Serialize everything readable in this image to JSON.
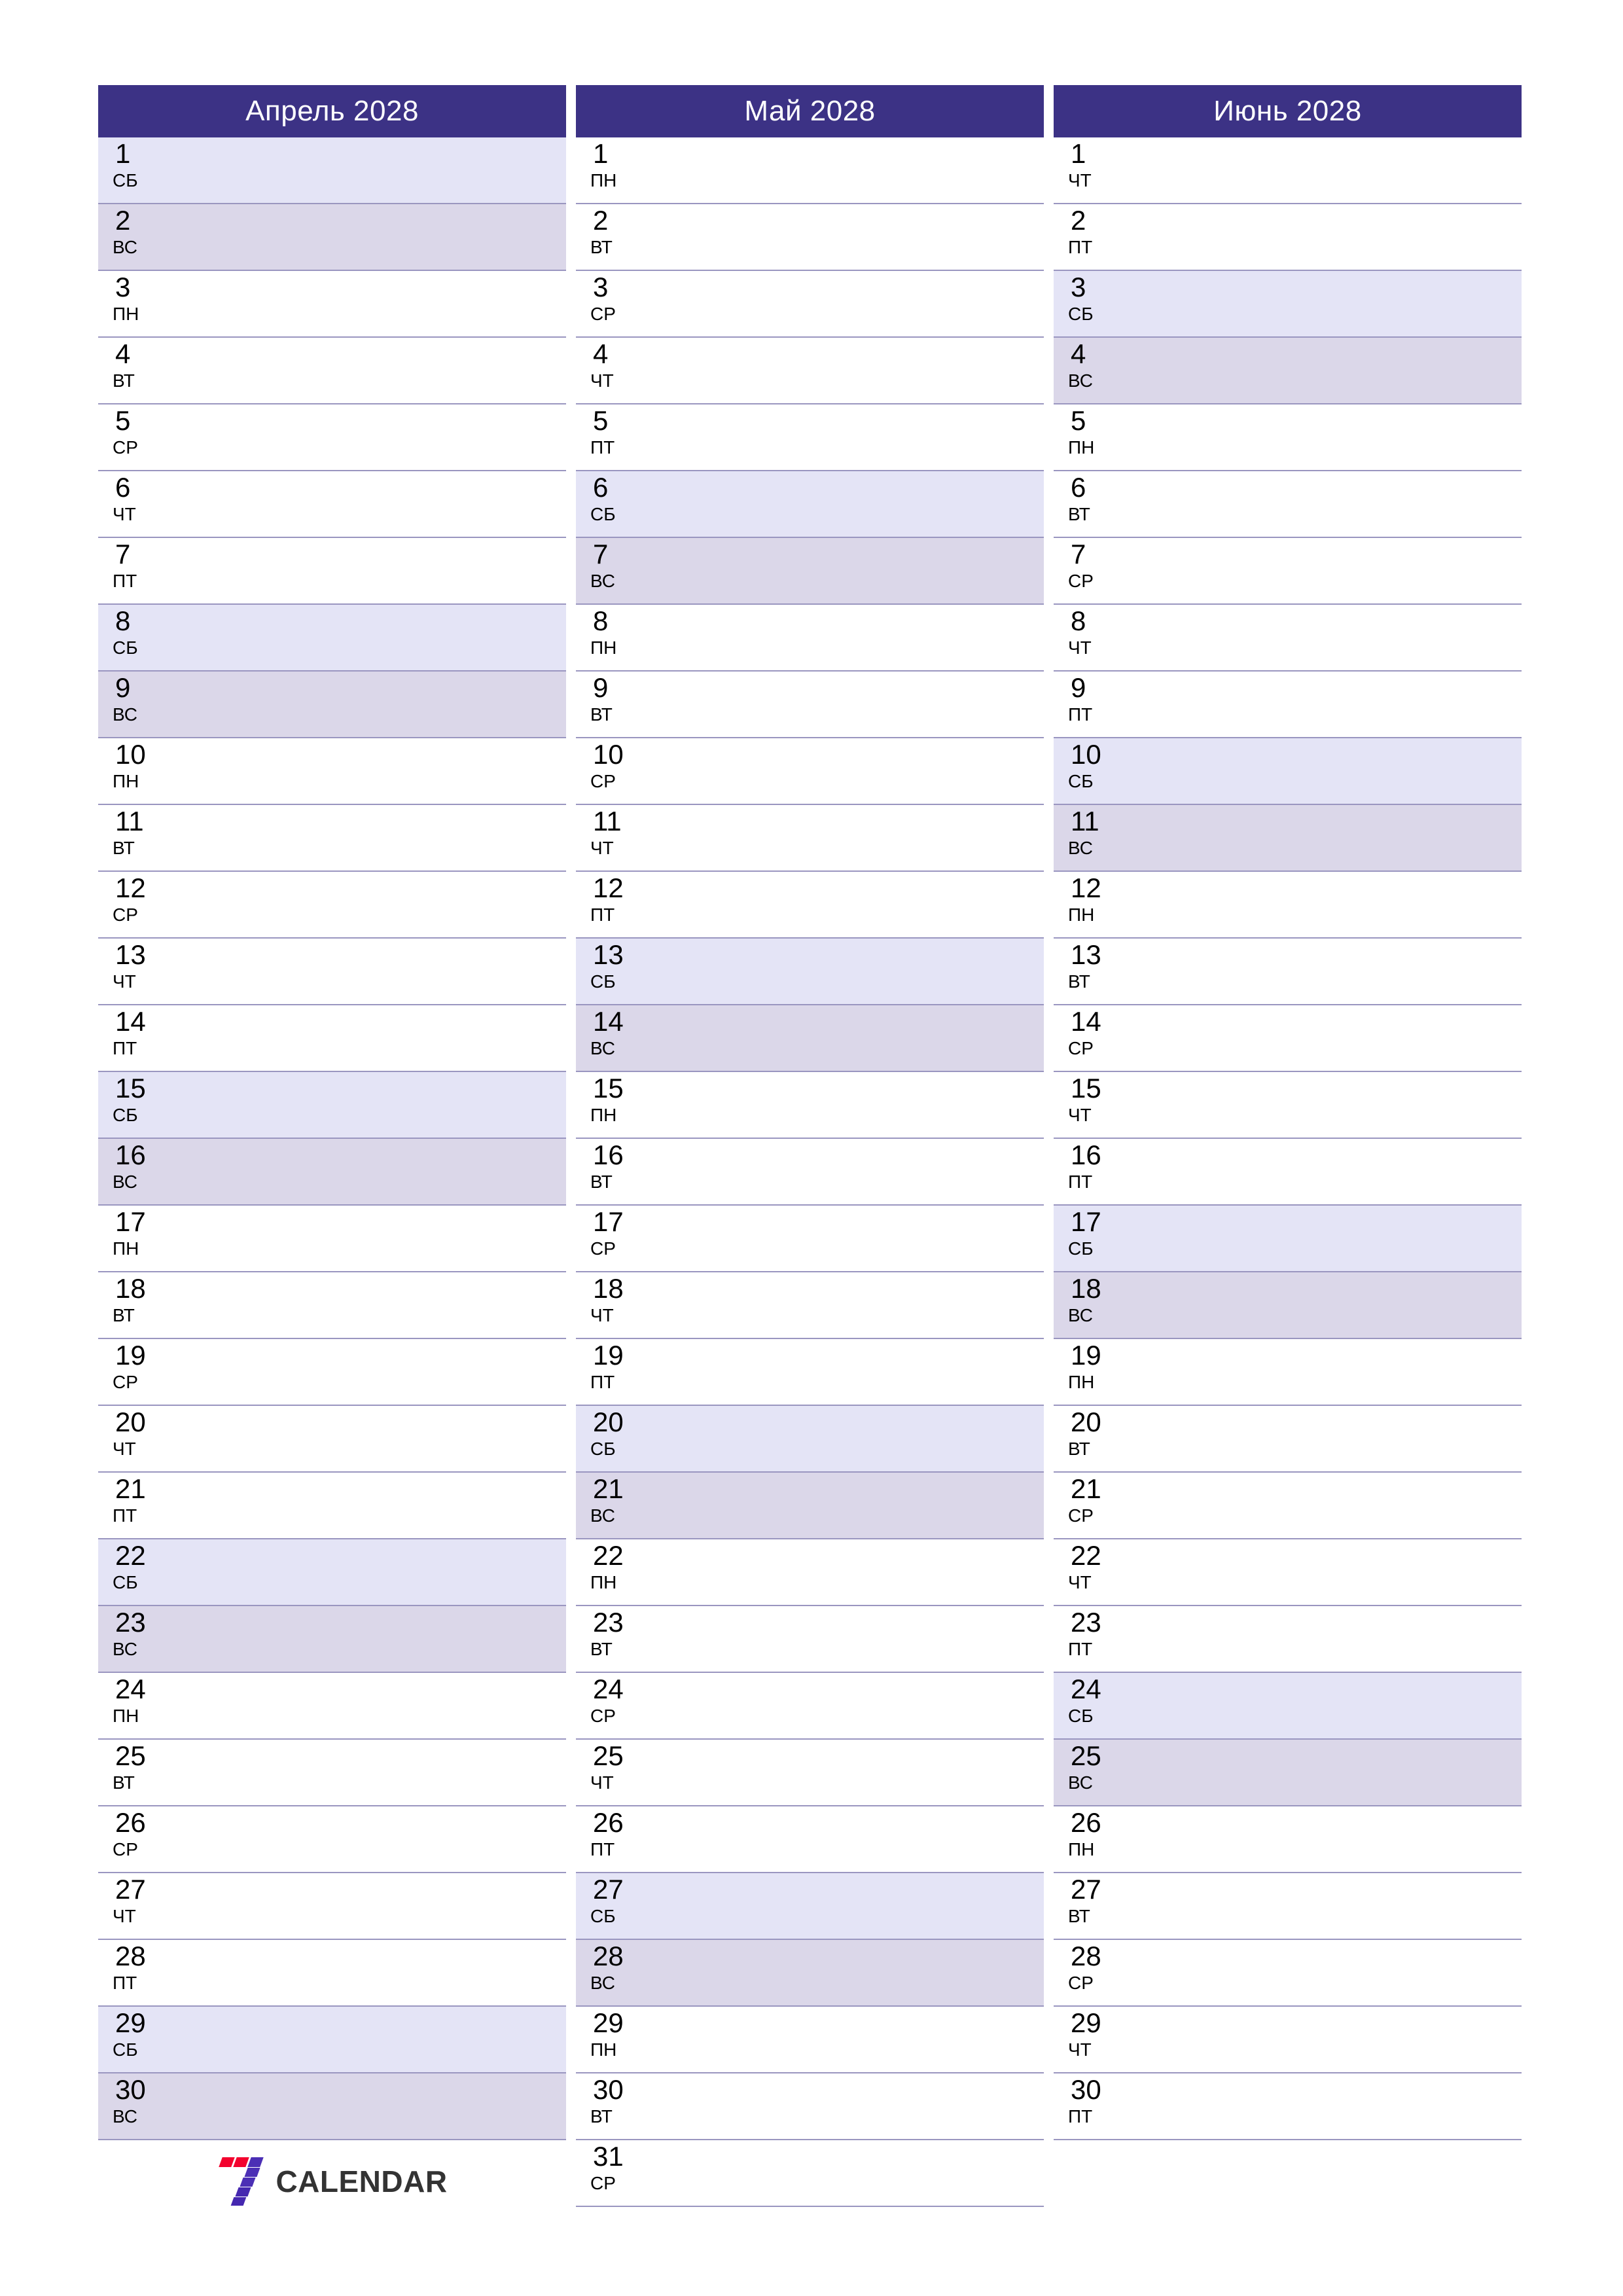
{
  "page": {
    "background": "#ffffff",
    "accent_header": "#3c3285",
    "saturday_bg": "#e4e4f6",
    "sunday_bg": "#dbd7e9",
    "row_divider": "#9a96c0",
    "text_color": "#000000"
  },
  "brand": {
    "text": "CALENDAR",
    "mark": "seven-logo-icon",
    "mark_colors": [
      "#f3022e",
      "#4b2fb5",
      "#4528b0"
    ]
  },
  "months": [
    {
      "title": "Апрель 2028",
      "days": [
        {
          "num": "1",
          "wd": "СБ",
          "kind": "sat"
        },
        {
          "num": "2",
          "wd": "ВС",
          "kind": "sun"
        },
        {
          "num": "3",
          "wd": "ПН",
          "kind": "weekday"
        },
        {
          "num": "4",
          "wd": "ВТ",
          "kind": "weekday"
        },
        {
          "num": "5",
          "wd": "СР",
          "kind": "weekday"
        },
        {
          "num": "6",
          "wd": "ЧТ",
          "kind": "weekday"
        },
        {
          "num": "7",
          "wd": "ПТ",
          "kind": "weekday"
        },
        {
          "num": "8",
          "wd": "СБ",
          "kind": "sat"
        },
        {
          "num": "9",
          "wd": "ВС",
          "kind": "sun"
        },
        {
          "num": "10",
          "wd": "ПН",
          "kind": "weekday"
        },
        {
          "num": "11",
          "wd": "ВТ",
          "kind": "weekday"
        },
        {
          "num": "12",
          "wd": "СР",
          "kind": "weekday"
        },
        {
          "num": "13",
          "wd": "ЧТ",
          "kind": "weekday"
        },
        {
          "num": "14",
          "wd": "ПТ",
          "kind": "weekday"
        },
        {
          "num": "15",
          "wd": "СБ",
          "kind": "sat"
        },
        {
          "num": "16",
          "wd": "ВС",
          "kind": "sun"
        },
        {
          "num": "17",
          "wd": "ПН",
          "kind": "weekday"
        },
        {
          "num": "18",
          "wd": "ВТ",
          "kind": "weekday"
        },
        {
          "num": "19",
          "wd": "СР",
          "kind": "weekday"
        },
        {
          "num": "20",
          "wd": "ЧТ",
          "kind": "weekday"
        },
        {
          "num": "21",
          "wd": "ПТ",
          "kind": "weekday"
        },
        {
          "num": "22",
          "wd": "СБ",
          "kind": "sat"
        },
        {
          "num": "23",
          "wd": "ВС",
          "kind": "sun"
        },
        {
          "num": "24",
          "wd": "ПН",
          "kind": "weekday"
        },
        {
          "num": "25",
          "wd": "ВТ",
          "kind": "weekday"
        },
        {
          "num": "26",
          "wd": "СР",
          "kind": "weekday"
        },
        {
          "num": "27",
          "wd": "ЧТ",
          "kind": "weekday"
        },
        {
          "num": "28",
          "wd": "ПТ",
          "kind": "weekday"
        },
        {
          "num": "29",
          "wd": "СБ",
          "kind": "sat"
        },
        {
          "num": "30",
          "wd": "ВС",
          "kind": "sun"
        }
      ]
    },
    {
      "title": "Май 2028",
      "days": [
        {
          "num": "1",
          "wd": "ПН",
          "kind": "weekday"
        },
        {
          "num": "2",
          "wd": "ВТ",
          "kind": "weekday"
        },
        {
          "num": "3",
          "wd": "СР",
          "kind": "weekday"
        },
        {
          "num": "4",
          "wd": "ЧТ",
          "kind": "weekday"
        },
        {
          "num": "5",
          "wd": "ПТ",
          "kind": "weekday"
        },
        {
          "num": "6",
          "wd": "СБ",
          "kind": "sat"
        },
        {
          "num": "7",
          "wd": "ВС",
          "kind": "sun"
        },
        {
          "num": "8",
          "wd": "ПН",
          "kind": "weekday"
        },
        {
          "num": "9",
          "wd": "ВТ",
          "kind": "weekday"
        },
        {
          "num": "10",
          "wd": "СР",
          "kind": "weekday"
        },
        {
          "num": "11",
          "wd": "ЧТ",
          "kind": "weekday"
        },
        {
          "num": "12",
          "wd": "ПТ",
          "kind": "weekday"
        },
        {
          "num": "13",
          "wd": "СБ",
          "kind": "sat"
        },
        {
          "num": "14",
          "wd": "ВС",
          "kind": "sun"
        },
        {
          "num": "15",
          "wd": "ПН",
          "kind": "weekday"
        },
        {
          "num": "16",
          "wd": "ВТ",
          "kind": "weekday"
        },
        {
          "num": "17",
          "wd": "СР",
          "kind": "weekday"
        },
        {
          "num": "18",
          "wd": "ЧТ",
          "kind": "weekday"
        },
        {
          "num": "19",
          "wd": "ПТ",
          "kind": "weekday"
        },
        {
          "num": "20",
          "wd": "СБ",
          "kind": "sat"
        },
        {
          "num": "21",
          "wd": "ВС",
          "kind": "sun"
        },
        {
          "num": "22",
          "wd": "ПН",
          "kind": "weekday"
        },
        {
          "num": "23",
          "wd": "ВТ",
          "kind": "weekday"
        },
        {
          "num": "24",
          "wd": "СР",
          "kind": "weekday"
        },
        {
          "num": "25",
          "wd": "ЧТ",
          "kind": "weekday"
        },
        {
          "num": "26",
          "wd": "ПТ",
          "kind": "weekday"
        },
        {
          "num": "27",
          "wd": "СБ",
          "kind": "sat"
        },
        {
          "num": "28",
          "wd": "ВС",
          "kind": "sun"
        },
        {
          "num": "29",
          "wd": "ПН",
          "kind": "weekday"
        },
        {
          "num": "30",
          "wd": "ВТ",
          "kind": "weekday"
        },
        {
          "num": "31",
          "wd": "СР",
          "kind": "weekday"
        }
      ]
    },
    {
      "title": "Июнь 2028",
      "days": [
        {
          "num": "1",
          "wd": "ЧТ",
          "kind": "weekday"
        },
        {
          "num": "2",
          "wd": "ПТ",
          "kind": "weekday"
        },
        {
          "num": "3",
          "wd": "СБ",
          "kind": "sat"
        },
        {
          "num": "4",
          "wd": "ВС",
          "kind": "sun"
        },
        {
          "num": "5",
          "wd": "ПН",
          "kind": "weekday"
        },
        {
          "num": "6",
          "wd": "ВТ",
          "kind": "weekday"
        },
        {
          "num": "7",
          "wd": "СР",
          "kind": "weekday"
        },
        {
          "num": "8",
          "wd": "ЧТ",
          "kind": "weekday"
        },
        {
          "num": "9",
          "wd": "ПТ",
          "kind": "weekday"
        },
        {
          "num": "10",
          "wd": "СБ",
          "kind": "sat"
        },
        {
          "num": "11",
          "wd": "ВС",
          "kind": "sun"
        },
        {
          "num": "12",
          "wd": "ПН",
          "kind": "weekday"
        },
        {
          "num": "13",
          "wd": "ВТ",
          "kind": "weekday"
        },
        {
          "num": "14",
          "wd": "СР",
          "kind": "weekday"
        },
        {
          "num": "15",
          "wd": "ЧТ",
          "kind": "weekday"
        },
        {
          "num": "16",
          "wd": "ПТ",
          "kind": "weekday"
        },
        {
          "num": "17",
          "wd": "СБ",
          "kind": "sat"
        },
        {
          "num": "18",
          "wd": "ВС",
          "kind": "sun"
        },
        {
          "num": "19",
          "wd": "ПН",
          "kind": "weekday"
        },
        {
          "num": "20",
          "wd": "ВТ",
          "kind": "weekday"
        },
        {
          "num": "21",
          "wd": "СР",
          "kind": "weekday"
        },
        {
          "num": "22",
          "wd": "ЧТ",
          "kind": "weekday"
        },
        {
          "num": "23",
          "wd": "ПТ",
          "kind": "weekday"
        },
        {
          "num": "24",
          "wd": "СБ",
          "kind": "sat"
        },
        {
          "num": "25",
          "wd": "ВС",
          "kind": "sun"
        },
        {
          "num": "26",
          "wd": "ПН",
          "kind": "weekday"
        },
        {
          "num": "27",
          "wd": "ВТ",
          "kind": "weekday"
        },
        {
          "num": "28",
          "wd": "СР",
          "kind": "weekday"
        },
        {
          "num": "29",
          "wd": "ЧТ",
          "kind": "weekday"
        },
        {
          "num": "30",
          "wd": "ПТ",
          "kind": "weekday"
        }
      ]
    }
  ]
}
